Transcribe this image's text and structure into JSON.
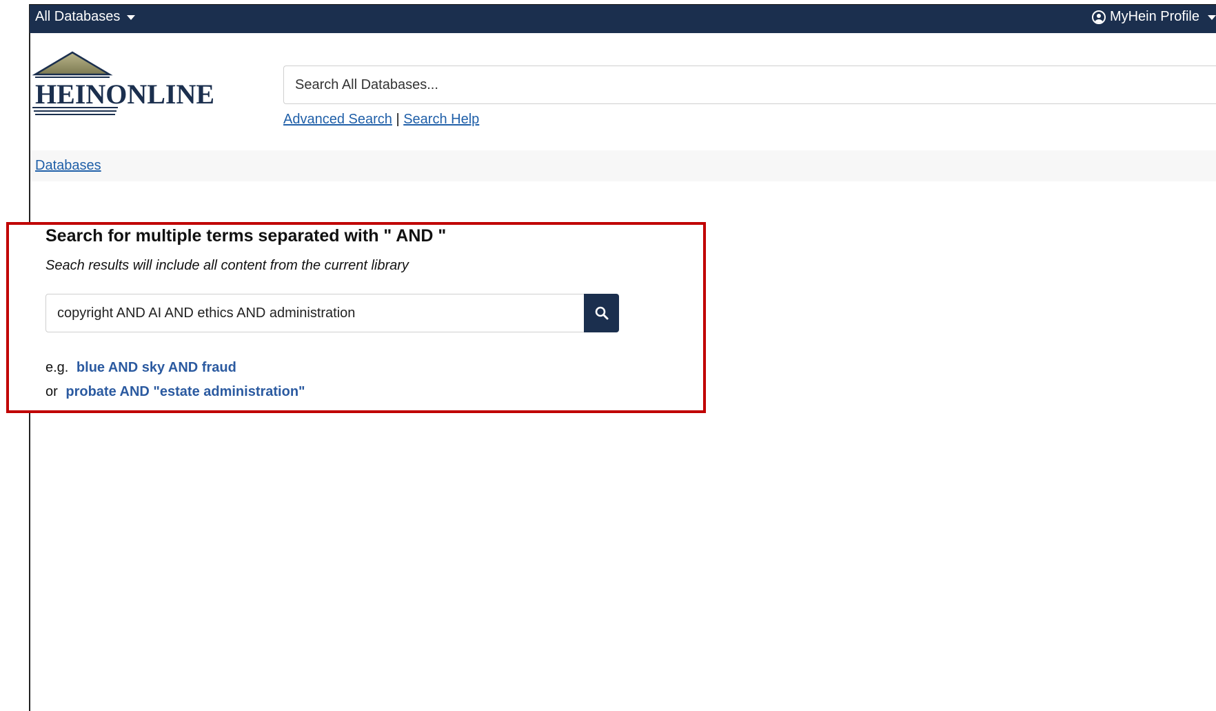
{
  "topbar": {
    "databases_menu": "All Databases",
    "profile_menu": "MyHein Profile"
  },
  "logo": {
    "text": "HEINONLINE"
  },
  "search": {
    "placeholder": "Search All Databases...",
    "advanced_link": "Advanced Search",
    "separator": "|",
    "help_link": "Search Help"
  },
  "breadcrumb": {
    "databases": "Databases"
  },
  "multi_term": {
    "title": "Search for multiple terms separated with \" AND \"",
    "subtitle": "Seach results will include all content from the current library",
    "input_value": "copyright AND AI AND ethics AND administration",
    "example1_prefix": "e.g.",
    "example1_link": "blue AND sky AND fraud",
    "example2_prefix": "or",
    "example2_link": "probate AND \"estate administration\""
  },
  "icons": {
    "search_button": "search-icon",
    "profile": "user-circle-icon",
    "dropdown": "caret-down-icon"
  },
  "colors": {
    "navy": "#1b2f4e",
    "link_blue": "#1f5fa8",
    "highlight_red": "#c00000"
  }
}
